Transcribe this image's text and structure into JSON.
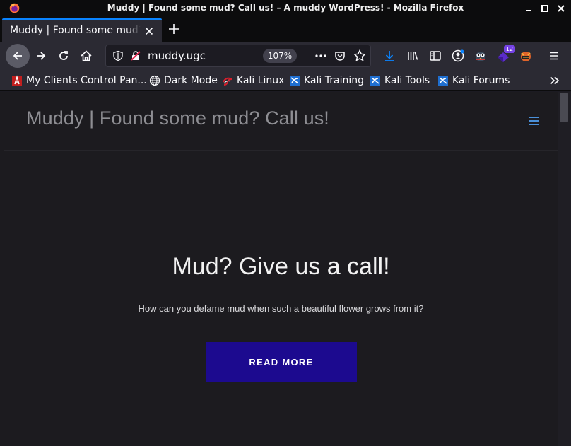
{
  "window": {
    "title": "Muddy | Found some mud? Call us! – A muddy WordPress! - Mozilla Firefox"
  },
  "tab": {
    "title": "Muddy | Found some mud? C"
  },
  "navbar": {
    "url": "muddy.ugc",
    "zoom": "107%",
    "extension_badge": "12"
  },
  "bookmarks": [
    {
      "label": "My Clients Control Pan...",
      "icon": "bookmark-favicon"
    },
    {
      "label": "Dark Mode",
      "icon": "globe-icon"
    },
    {
      "label": "Kali Linux",
      "icon": "kali-icon"
    },
    {
      "label": "Kali Training",
      "icon": "kali-icon"
    },
    {
      "label": "Kali Tools",
      "icon": "kali-icon"
    },
    {
      "label": "Kali Forums",
      "icon": "kali-icon"
    }
  ],
  "page": {
    "site_title": "Muddy | Found some mud? Call us!",
    "hero_title": "Mud? Give us a call!",
    "hero_subtitle": "How can you defame mud when such a beautiful flower grows from it?",
    "cta_label": "READ MORE"
  },
  "colors": {
    "accent": "#0a84ff",
    "cta_bg": "#1c0a8f",
    "menu_toggle": "#4a90d9"
  }
}
